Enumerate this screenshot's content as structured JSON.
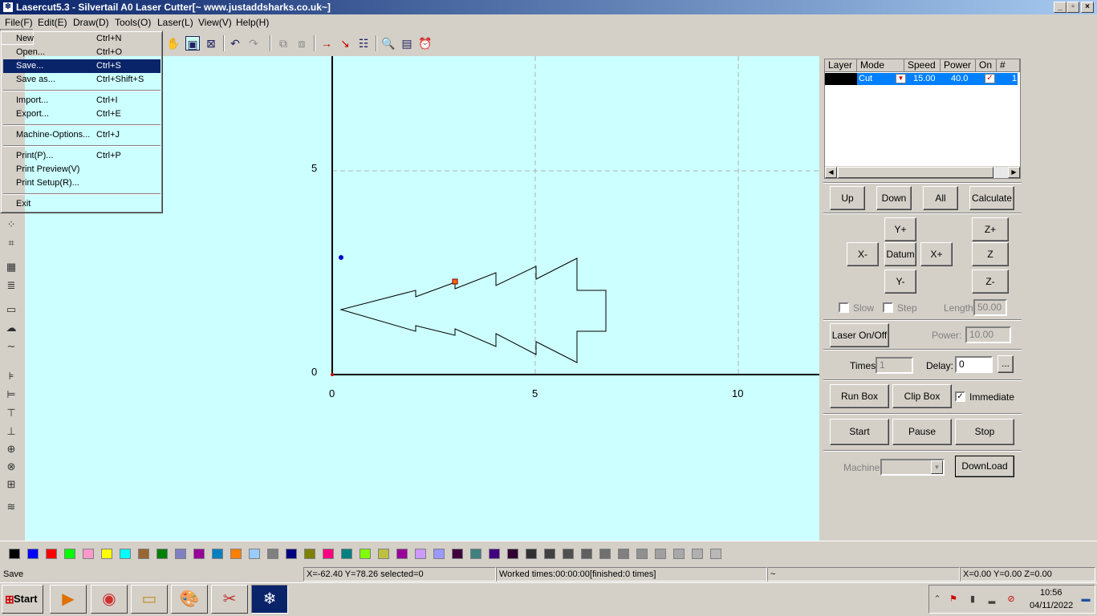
{
  "window": {
    "title": "Lasercut5.3 - Silvertail A0 Laser Cutter[~ www.justaddsharks.co.uk~]",
    "controls": {
      "minimize": "_",
      "restore": "▫",
      "close": "×"
    }
  },
  "menubar": [
    {
      "label": "File(F)"
    },
    {
      "label": "Edit(E)"
    },
    {
      "label": "Draw(D)"
    },
    {
      "label": "Tools(O)"
    },
    {
      "label": "Laser(L)"
    },
    {
      "label": "View(V)"
    },
    {
      "label": "Help(H)"
    }
  ],
  "file_menu": [
    {
      "label": "New",
      "shortcut": "Ctrl+N"
    },
    {
      "label": "Open...",
      "shortcut": "Ctrl+O"
    },
    {
      "label": "Save...",
      "shortcut": "Ctrl+S",
      "selected": true
    },
    {
      "label": "Save as...",
      "shortcut": "Ctrl+Shift+S"
    },
    {
      "label": "Import...",
      "shortcut": "Ctrl+I"
    },
    {
      "label": "Export...",
      "shortcut": "Ctrl+E"
    },
    {
      "label": "Machine-Options...",
      "shortcut": "Ctrl+J"
    },
    {
      "label": "Print(P)...",
      "shortcut": "Ctrl+P"
    },
    {
      "label": "Print Preview(V)",
      "shortcut": ""
    },
    {
      "label": "Print Setup(R)...",
      "shortcut": ""
    },
    {
      "label": "Exit",
      "shortcut": ""
    }
  ],
  "canvas": {
    "axis_labels_y": [
      "5",
      "0"
    ],
    "axis_labels_x": [
      "0",
      "5",
      "10"
    ]
  },
  "layer_table": {
    "headers": [
      "Layer",
      "Mode",
      "Speed",
      "Power",
      "On",
      "#"
    ],
    "rows": [
      {
        "layer_color": "#000000",
        "mode": "Cut",
        "speed": "15.00",
        "power": "40.0",
        "on": true,
        "num": "1"
      }
    ]
  },
  "panel": {
    "layer_buttons": {
      "up": "Up",
      "down": "Down",
      "all": "All",
      "calculate": "Calculate"
    },
    "jog": {
      "y_plus": "Y+",
      "y_minus": "Y-",
      "x_minus": "X-",
      "x_plus": "X+",
      "datum": "Datum",
      "z_plus": "Z+",
      "z_datum": "Z Datum",
      "z_minus": "Z-"
    },
    "slow_label": "Slow",
    "step_label": "Step",
    "length_label": "Length:",
    "length_value": "50.00",
    "laser_onoff": "Laser On/Off",
    "power_label": "Power:",
    "power_value": "10.00",
    "times_label": "Times:",
    "times_value": "1",
    "delay_label": "Delay:",
    "delay_value": "0",
    "delay_browse": "...",
    "run_box": "Run Box",
    "clip_box": "Clip Box",
    "immediate_label": "Immediate",
    "immediate_checked": true,
    "start": "Start",
    "pause": "Pause",
    "stop": "Stop",
    "machine_label": "Machine:",
    "machine_value": "",
    "download": "DownLoad"
  },
  "palette": [
    "#000000",
    "#0000ff",
    "#ff0000",
    "#00ff00",
    "#ff99cc",
    "#ffff00",
    "#00ffff",
    "#996633",
    "#008000",
    "#8080c0",
    "#990099",
    "#0080c0",
    "#ff8000",
    "#99ccff",
    "#808080",
    "#000080",
    "#808000",
    "#ff0080",
    "#008080",
    "#80ff00",
    "#c0c040",
    "#990099",
    "#cc99ff",
    "#9999ff",
    "#400040",
    "#408080",
    "#400080",
    "#300030",
    "#303030",
    "#404040",
    "#505050",
    "#606060",
    "#707070",
    "#808080",
    "#909090",
    "#a0a0a0",
    "#a8a8a8",
    "#b0b0b0",
    "#b8b8b8"
  ],
  "status": {
    "message": "Save",
    "coords": "X=-62.40 Y=78.26 selected=0",
    "worked": "Worked times:00:00:00[finished:0 times]",
    "misc": "~",
    "position": "X=0.00 Y=0.00 Z=0.00"
  },
  "taskbar": {
    "start_label": "Start",
    "apps": [
      "media-player-icon",
      "chrome-icon",
      "file-explorer-icon",
      "paint-icon",
      "snipping-tool-icon",
      "lasercut-icon"
    ],
    "clock_time": "10:56",
    "clock_date": "04/11/2022"
  }
}
